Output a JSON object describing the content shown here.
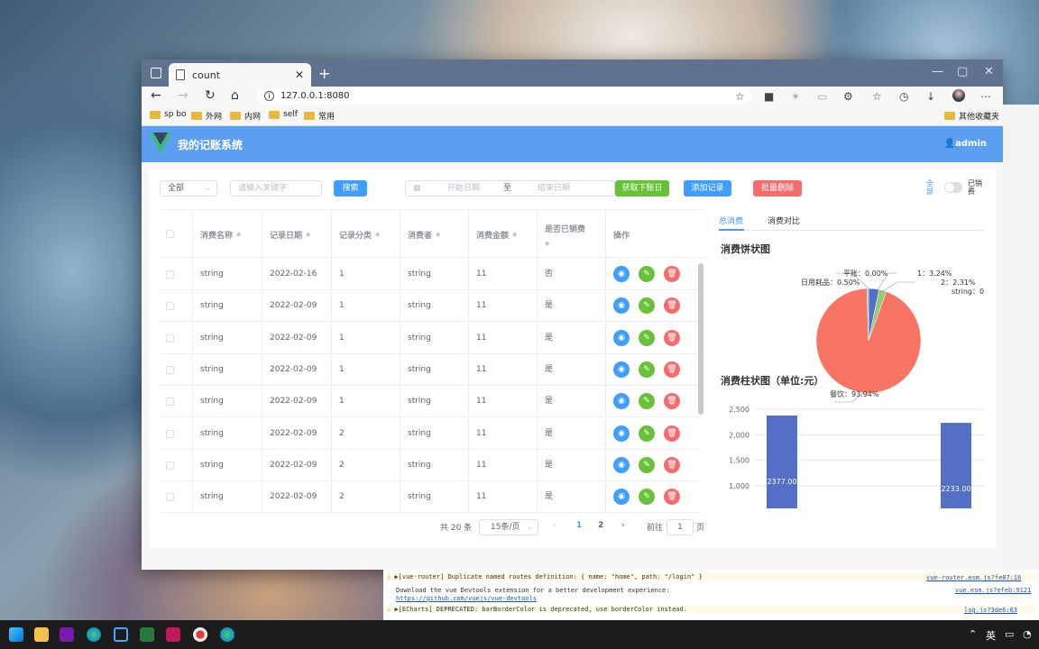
{
  "browser": {
    "tab_title": "count",
    "url": "127.0.0.1:8080",
    "bookmarks": [
      "sp bo",
      "外网",
      "内网",
      "self",
      "常用"
    ],
    "other_bookmarks": "其他收藏夹"
  },
  "app": {
    "title": "我的记账系统",
    "user": "admin",
    "accent": "#5c9ff0"
  },
  "toolbar": {
    "scope_select": "全部",
    "keyword_placeholder": "请输入关键字",
    "search_label": "搜索",
    "start_date_placeholder": "开始日期",
    "date_separator": "至",
    "end_date_placeholder": "结束日期",
    "fetch_bill_label": "获取下账日",
    "add_record_label": "添加记录",
    "batch_delete_label": "批量删除",
    "switch_left": "全部",
    "switch_right": "已销费"
  },
  "table": {
    "headers": [
      "消费名称",
      "记录日期",
      "记录分类",
      "消费者",
      "消费金额",
      "是否已销费",
      "操作"
    ],
    "rows": [
      {
        "name": "string",
        "date": "2022-02-16",
        "category": "1",
        "consumer": "string",
        "amount": "11",
        "settled": "否"
      },
      {
        "name": "string",
        "date": "2022-02-09",
        "category": "1",
        "consumer": "string",
        "amount": "11",
        "settled": "是"
      },
      {
        "name": "string",
        "date": "2022-02-09",
        "category": "1",
        "consumer": "string",
        "amount": "11",
        "settled": "是"
      },
      {
        "name": "string",
        "date": "2022-02-09",
        "category": "1",
        "consumer": "string",
        "amount": "11",
        "settled": "是"
      },
      {
        "name": "string",
        "date": "2022-02-09",
        "category": "1",
        "consumer": "string",
        "amount": "11",
        "settled": "是"
      },
      {
        "name": "string",
        "date": "2022-02-09",
        "category": "2",
        "consumer": "string",
        "amount": "11",
        "settled": "是"
      },
      {
        "name": "string",
        "date": "2022-02-09",
        "category": "2",
        "consumer": "string",
        "amount": "11",
        "settled": "是"
      },
      {
        "name": "string",
        "date": "2022-02-09",
        "category": "2",
        "consumer": "string",
        "amount": "11",
        "settled": "是"
      }
    ]
  },
  "pagination": {
    "total": "共 20 条",
    "page_size": "15条/页",
    "pages": [
      "1",
      "2"
    ],
    "current_page": "1",
    "goto_label": "前往",
    "goto_value": "1",
    "page_suffix": "页"
  },
  "right_panel": {
    "tabs": [
      "总消费",
      "消费对比"
    ],
    "pie_title": "消费饼状图",
    "bar_title": "消费柱状图（单位:元）"
  },
  "chart_data": [
    {
      "type": "pie",
      "title": "消费饼状图",
      "labels": [
        "1",
        "2",
        "string",
        "餐饮",
        "日用耗品",
        "平账"
      ],
      "values": [
        3.24,
        2.31,
        0,
        93.94,
        0.5,
        0.0
      ],
      "label_text": [
        "1：3.24%",
        "2：2.31%",
        "string：0",
        "餐饮：93.94%",
        "日用耗品：0.50%",
        "平账：0.00%"
      ],
      "colors": [
        "#5470c6",
        "#91cc75",
        "#fac858",
        "#ee6666",
        "#73c0de",
        "#3ba272"
      ]
    },
    {
      "type": "bar",
      "title": "消费柱状图（单位:元）",
      "values": [
        2377.0,
        2233.0
      ],
      "value_labels": [
        "2377.00",
        "2233.00"
      ],
      "ylim": [
        1000,
        2500
      ],
      "yticks": [
        "2,500",
        "2,000",
        "1,500",
        "1,000"
      ],
      "color": "#5470c6"
    }
  ],
  "devtools": {
    "lines": [
      "▶[vue-router] Duplicate named routes definition: { name: \"home\", path: \"/login\" }",
      "Download the vue Devtools extension for a better development experience:",
      "https://github.com/vuejs/vue-devtools",
      "▶[ECharts] DEPRECATED: barBorderColor is deprecated, use borderColor instead."
    ],
    "sources": [
      "vue-router.esm.js?fe87:16",
      "vue.esm.js?efeb:9121",
      "log.js?3de6:63"
    ]
  },
  "taskbar": {
    "ime": "英"
  }
}
